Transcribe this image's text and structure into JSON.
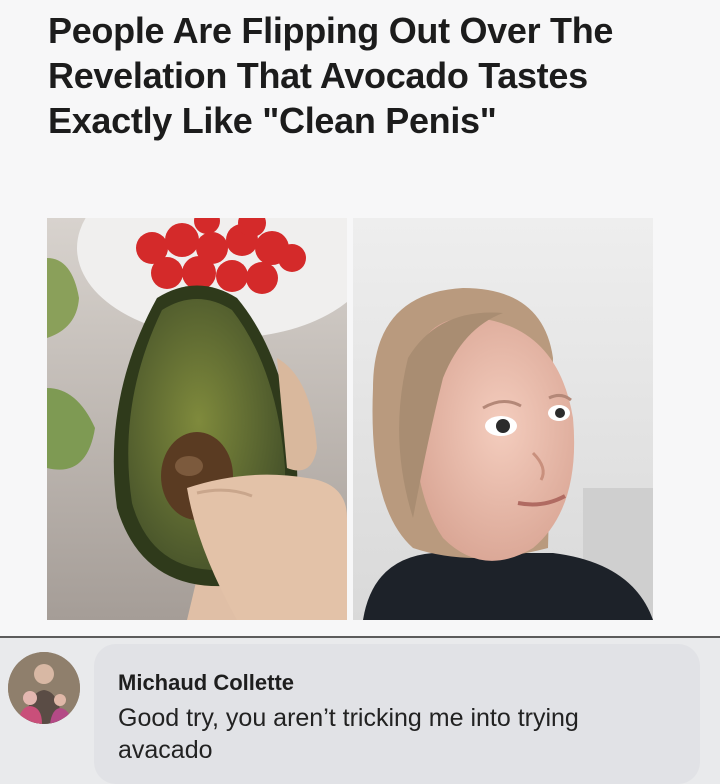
{
  "article": {
    "headline": "People Are Flipping Out Over The Revelation That Avocado Tastes Exactly Like \"Clean Penis\""
  },
  "photos": {
    "left_icon": "avocado-photo",
    "right_icon": "woman-reaction-photo"
  },
  "comment": {
    "author": "Michaud Collette",
    "text": "Good try, you aren’t tricking me into trying avacado",
    "avatar_icon": "avatar-photo"
  },
  "colors": {
    "page_bg": "#f7f7f8",
    "comment_bubble": "#e1e2e6",
    "headline_text": "#1c1c1c"
  }
}
